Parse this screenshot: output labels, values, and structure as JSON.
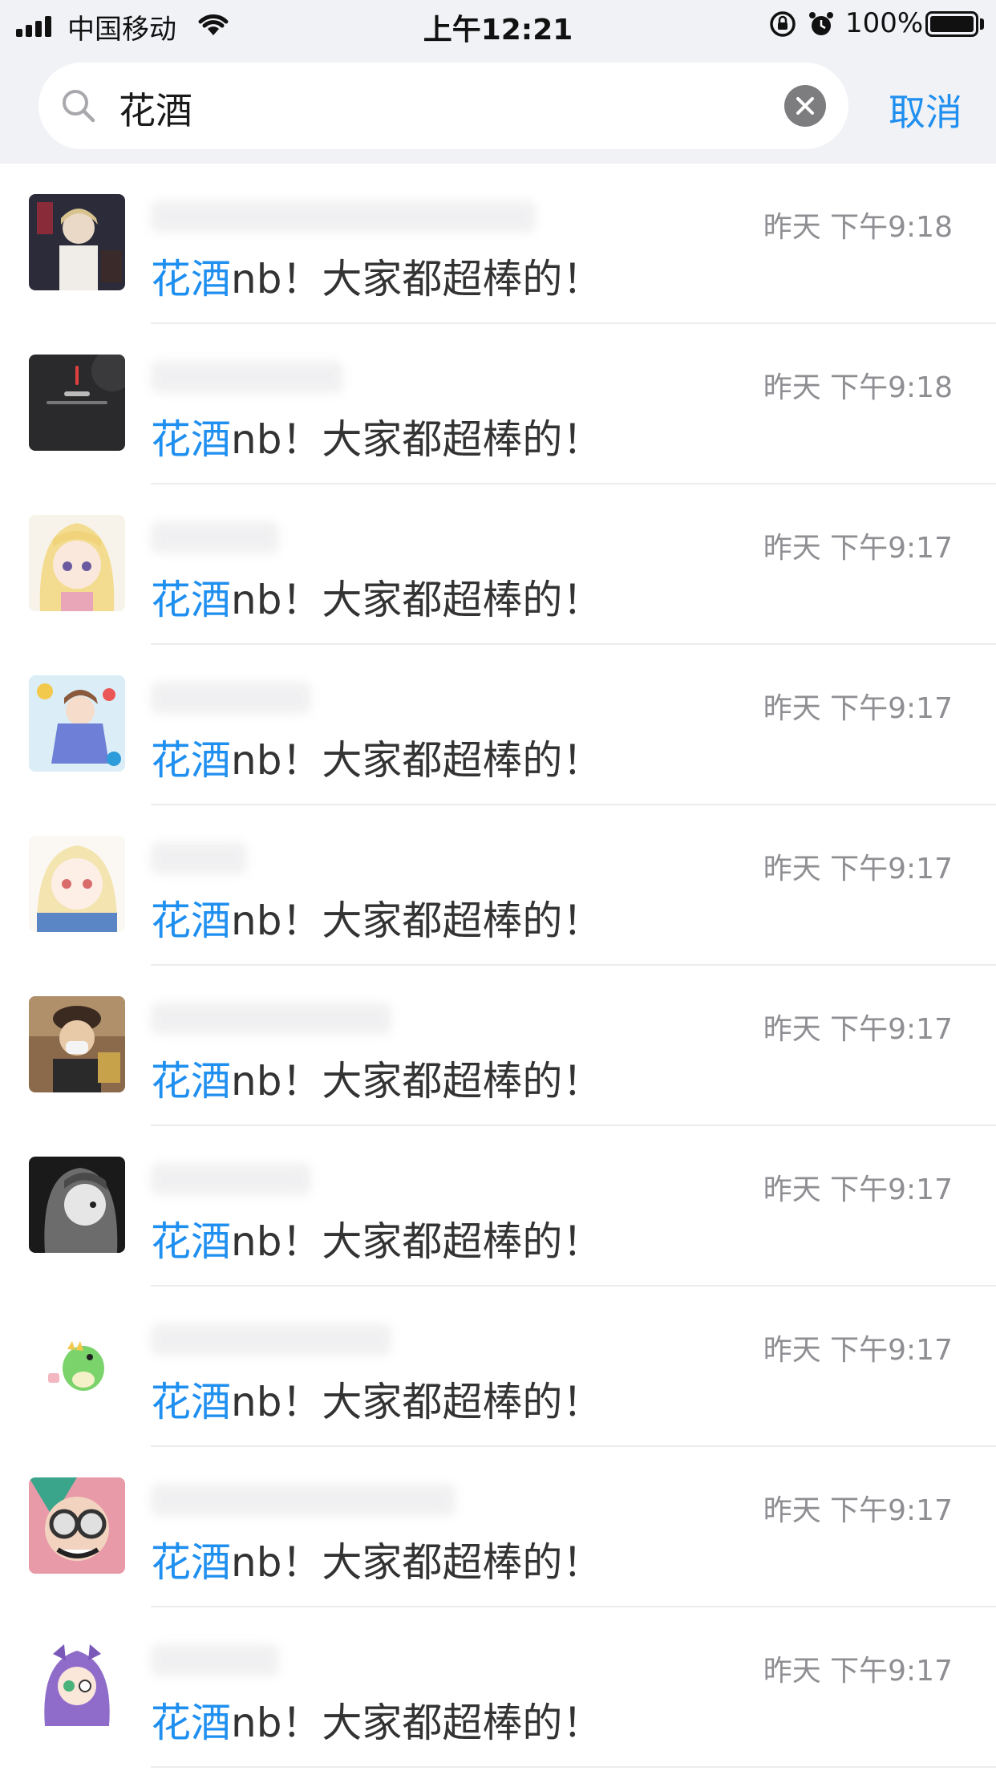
{
  "status_bar": {
    "carrier": "中国移动",
    "time": "上午12:21",
    "battery": "100%"
  },
  "search": {
    "query": "花酒",
    "cancel_label": "取消"
  },
  "colors": {
    "accent": "#1f8ff0",
    "header_bg": "#f1f2f6",
    "time_gray": "#8e8e93"
  },
  "results": [
    {
      "time": "昨天 下午9:18",
      "highlight": "花酒",
      "rest": "nb！大家都超棒的！",
      "avatar": "anime-avatar-dark"
    },
    {
      "time": "昨天 下午9:18",
      "highlight": "花酒",
      "rest": "nb！大家都超棒的！",
      "avatar": "temperature-widget-avatar"
    },
    {
      "time": "昨天 下午9:17",
      "highlight": "花酒",
      "rest": "nb！大家都超棒的！",
      "avatar": "anime-avatar-blonde"
    },
    {
      "time": "昨天 下午9:17",
      "highlight": "花酒",
      "rest": "nb！大家都超棒的！",
      "avatar": "anime-avatar-colorful"
    },
    {
      "time": "昨天 下午9:17",
      "highlight": "花酒",
      "rest": "nb！大家都超棒的！",
      "avatar": "anime-avatar-pale"
    },
    {
      "time": "昨天 下午9:17",
      "highlight": "花酒",
      "rest": "nb！大家都超棒的！",
      "avatar": "photo-avatar-cap"
    },
    {
      "time": "昨天 下午9:17",
      "highlight": "花酒",
      "rest": "nb！大家都超棒的！",
      "avatar": "anime-avatar-monochrome"
    },
    {
      "time": "昨天 下午9:17",
      "highlight": "花酒",
      "rest": "nb！大家都超棒的！",
      "avatar": "dinosaur-sticker-avatar"
    },
    {
      "time": "昨天 下午9:17",
      "highlight": "花酒",
      "rest": "nb！大家都超棒的！",
      "avatar": "anime-avatar-goggles"
    },
    {
      "time": "昨天 下午9:17",
      "highlight": "花酒",
      "rest": "nb！大家都超棒的！",
      "avatar": "anime-avatar-purple"
    }
  ]
}
